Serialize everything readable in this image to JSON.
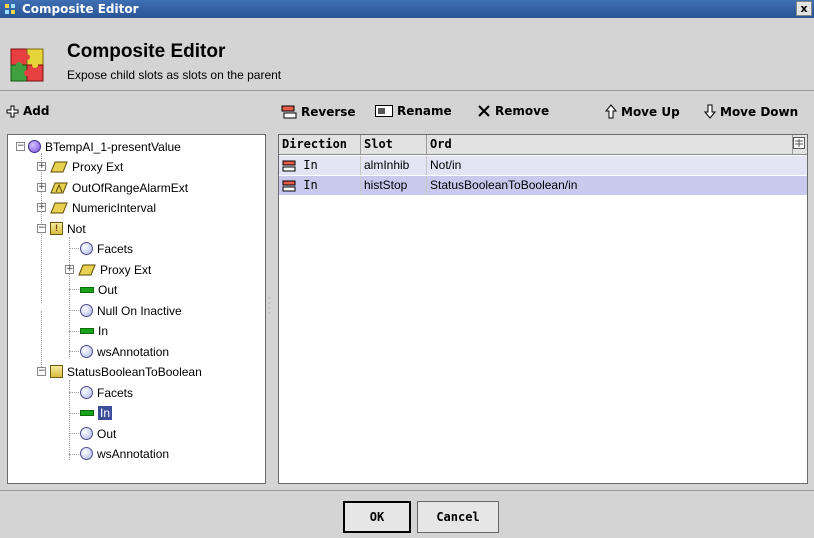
{
  "window": {
    "title": "Composite Editor",
    "close_label": "x"
  },
  "header": {
    "title": "Composite Editor",
    "subtitle": "Expose child slots as slots on the parent"
  },
  "toolbar": {
    "add": "Add",
    "reverse": "Reverse",
    "rename": "Rename",
    "remove": "Remove",
    "move_up": "Move Up",
    "move_down": "Move Down"
  },
  "tree": {
    "root": "BTempAI_1-presentValue",
    "items": [
      "Proxy Ext",
      "OutOfRangeAlarmExt",
      "NumericInterval",
      "Not",
      "Facets",
      "Proxy Ext",
      "Out",
      "Null On Inactive",
      "In",
      "wsAnnotation",
      "StatusBooleanToBoolean",
      "Facets",
      "In",
      "Out",
      "wsAnnotation"
    ],
    "selected": "In"
  },
  "table": {
    "columns": [
      "Direction",
      "Slot",
      "Ord"
    ],
    "rows": [
      {
        "direction": "In",
        "slot": "almInhib",
        "ord": "Not/in"
      },
      {
        "direction": "In",
        "slot": "histStop",
        "ord": "StatusBooleanToBoolean/in"
      }
    ]
  },
  "buttons": {
    "ok": "OK",
    "cancel": "Cancel"
  }
}
